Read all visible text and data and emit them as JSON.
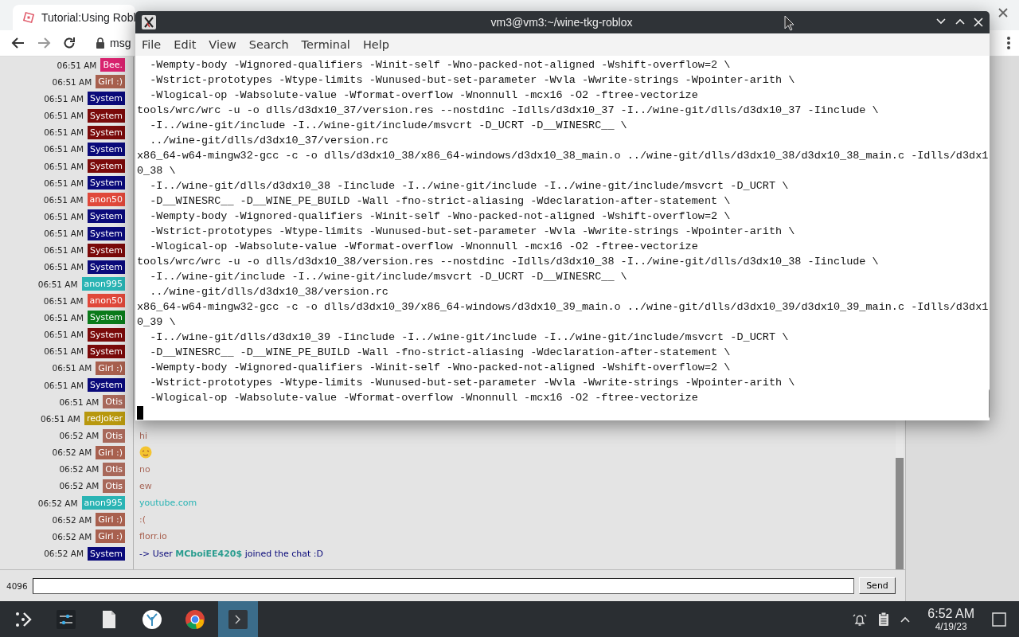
{
  "browser": {
    "tabs": [
      {
        "title": "Tutorial:Using Robl",
        "selected": true
      }
    ],
    "address": "msg"
  },
  "chat": {
    "rows": [
      {
        "time": "06:51 AM",
        "name": "Bee.",
        "color": "#d8226e"
      },
      {
        "time": "06:51 AM",
        "name": "Girl :)",
        "color": "#a8604e"
      },
      {
        "time": "06:51 AM",
        "name": "System",
        "color": "#0a0a7a"
      },
      {
        "time": "06:51 AM",
        "name": "System",
        "color": "#7a0a0a"
      },
      {
        "time": "06:51 AM",
        "name": "System",
        "color": "#7a0a0a"
      },
      {
        "time": "06:51 AM",
        "name": "System",
        "color": "#0a0a7a"
      },
      {
        "time": "06:51 AM",
        "name": "System",
        "color": "#7a0a0a"
      },
      {
        "time": "06:51 AM",
        "name": "System",
        "color": "#0a0a7a"
      },
      {
        "time": "06:51 AM",
        "name": "anon50",
        "color": "#e0483a"
      },
      {
        "time": "06:51 AM",
        "name": "System",
        "color": "#0a0a7a"
      },
      {
        "time": "06:51 AM",
        "name": "System",
        "color": "#0a0a7a"
      },
      {
        "time": "06:51 AM",
        "name": "System",
        "color": "#7a0a0a"
      },
      {
        "time": "06:51 AM",
        "name": "System",
        "color": "#0a0a7a"
      },
      {
        "time": "06:51 AM",
        "name": "anon995",
        "color": "#2ab4b4"
      },
      {
        "time": "06:51 AM",
        "name": "anon50",
        "color": "#e0483a"
      },
      {
        "time": "06:51 AM",
        "name": "System",
        "color": "#0a7a1a"
      },
      {
        "time": "06:51 AM",
        "name": "System",
        "color": "#7a0a0a"
      },
      {
        "time": "06:51 AM",
        "name": "System",
        "color": "#7a0a0a"
      },
      {
        "time": "06:51 AM",
        "name": "Girl :)",
        "color": "#a8604e"
      },
      {
        "time": "06:51 AM",
        "name": "System",
        "color": "#0a0a7a"
      },
      {
        "time": "06:51 AM",
        "name": "Otis",
        "color": "#a8685a"
      },
      {
        "time": "06:51 AM",
        "name": "redjoker",
        "color": "#b8980e"
      },
      {
        "time": "06:52 AM",
        "name": "Otis",
        "color": "#a8685a",
        "kind": "text",
        "message": "hi"
      },
      {
        "time": "06:52 AM",
        "name": "Girl :)",
        "color": "#a8604e",
        "kind": "emoji"
      },
      {
        "time": "06:52 AM",
        "name": "Otis",
        "color": "#a8685a",
        "kind": "text",
        "message": "no"
      },
      {
        "time": "06:52 AM",
        "name": "Otis",
        "color": "#a8685a",
        "kind": "text",
        "message": "ew"
      },
      {
        "time": "06:52 AM",
        "name": "anon995",
        "color": "#2ab4b4",
        "kind": "text",
        "message": "youtube.com"
      },
      {
        "time": "06:52 AM",
        "name": "Girl :)",
        "color": "#a8604e",
        "kind": "text",
        "message": ":("
      },
      {
        "time": "06:52 AM",
        "name": "Girl :)",
        "color": "#a8604e",
        "kind": "text",
        "message": "florr.io"
      },
      {
        "time": "06:52 AM",
        "name": "System",
        "color": "#0a0a7a",
        "kind": "text",
        "message": "-> User **MCboiEE420$** joined the chat :D"
      }
    ],
    "counter": "4096",
    "send": "Send"
  },
  "terminal": {
    "title": "vm3@vm3:~/wine-tkg-roblox",
    "menu": [
      "File",
      "Edit",
      "View",
      "Search",
      "Terminal",
      "Help"
    ],
    "lines": [
      "  -Wempty-body -Wignored-qualifiers -Winit-self -Wno-packed-not-aligned -Wshift-overflow=2 \\",
      "  -Wstrict-prototypes -Wtype-limits -Wunused-but-set-parameter -Wvla -Wwrite-strings -Wpointer-arith \\",
      "  -Wlogical-op -Wabsolute-value -Wformat-overflow -Wnonnull -mcx16 -O2 -ftree-vectorize",
      "tools/wrc/wrc -u -o dlls/d3dx10_37/version.res --nostdinc -Idlls/d3dx10_37 -I../wine-git/dlls/d3dx10_37 -Iinclude \\",
      "  -I../wine-git/include -I../wine-git/include/msvcrt -D_UCRT -D__WINESRC__ \\",
      "  ../wine-git/dlls/d3dx10_37/version.rc",
      "x86_64-w64-mingw32-gcc -c -o dlls/d3dx10_38/x86_64-windows/d3dx10_38_main.o ../wine-git/dlls/d3dx10_38/d3dx10_38_main.c -Idlls/d3dx1",
      "0_38 \\",
      "  -I../wine-git/dlls/d3dx10_38 -Iinclude -I../wine-git/include -I../wine-git/include/msvcrt -D_UCRT \\",
      "  -D__WINESRC__ -D__WINE_PE_BUILD -Wall -fno-strict-aliasing -Wdeclaration-after-statement \\",
      "  -Wempty-body -Wignored-qualifiers -Winit-self -Wno-packed-not-aligned -Wshift-overflow=2 \\",
      "  -Wstrict-prototypes -Wtype-limits -Wunused-but-set-parameter -Wvla -Wwrite-strings -Wpointer-arith \\",
      "  -Wlogical-op -Wabsolute-value -Wformat-overflow -Wnonnull -mcx16 -O2 -ftree-vectorize",
      "tools/wrc/wrc -u -o dlls/d3dx10_38/version.res --nostdinc -Idlls/d3dx10_38 -I../wine-git/dlls/d3dx10_38 -Iinclude \\",
      "  -I../wine-git/include -I../wine-git/include/msvcrt -D_UCRT -D__WINESRC__ \\",
      "  ../wine-git/dlls/d3dx10_38/version.rc",
      "x86_64-w64-mingw32-gcc -c -o dlls/d3dx10_39/x86_64-windows/d3dx10_39_main.o ../wine-git/dlls/d3dx10_39/d3dx10_39_main.c -Idlls/d3dx1",
      "0_39 \\",
      "  -I../wine-git/dlls/d3dx10_39 -Iinclude -I../wine-git/include -I../wine-git/include/msvcrt -D_UCRT \\",
      "  -D__WINESRC__ -D__WINE_PE_BUILD -Wall -fno-strict-aliasing -Wdeclaration-after-statement \\",
      "  -Wempty-body -Wignored-qualifiers -Winit-self -Wno-packed-not-aligned -Wshift-overflow=2 \\",
      "  -Wstrict-prototypes -Wtype-limits -Wunused-but-set-parameter -Wvla -Wwrite-strings -Wpointer-arith \\",
      "  -Wlogical-op -Wabsolute-value -Wformat-overflow -Wnonnull -mcx16 -O2 -ftree-vectorize"
    ]
  },
  "taskbar": {
    "apps": [
      {
        "kind": "launcher",
        "selected": false
      },
      {
        "kind": "settings",
        "selected": false
      },
      {
        "kind": "files",
        "selected": false
      },
      {
        "kind": "discover",
        "selected": false
      },
      {
        "kind": "browser",
        "selected": false
      },
      {
        "kind": "terminal",
        "selected": true
      }
    ],
    "time": "6:52 AM",
    "date": "4/19/23"
  }
}
